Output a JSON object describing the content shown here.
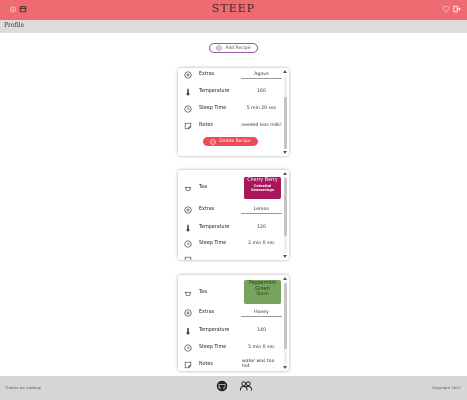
{
  "app": {
    "title": "STEEP",
    "page_title": "Profile"
  },
  "colors": {
    "brand": "#ef6b72",
    "accent": "#9a5aa5",
    "delete": "#ef4a55"
  },
  "header": {
    "left_icons": [
      "tea-cup-icon",
      "tea-tin-icon"
    ],
    "right_icons": [
      "heart-icon",
      "logout-icon"
    ]
  },
  "add_button": {
    "label": "Add Recipe",
    "icon": "plus-circle-icon"
  },
  "labels": {
    "tea": "Tea",
    "extras": "Extras",
    "temperature": "Temperature",
    "steep_time": "Steep Time",
    "notes": "Notes",
    "delete": "Delete Recipe"
  },
  "recipes": [
    {
      "extras": "Agave",
      "temperature": "160",
      "steep_time": "5 min 20 sec",
      "notes": "needed less milk!"
    },
    {
      "tea_name": "Cherry Berry",
      "tea_brand": "Celestial Seasonings",
      "tea_color": "#a8165b",
      "extras": "Lemon",
      "temperature": "120",
      "steep_time": "2 min 0 sec"
    },
    {
      "tea_name": "Peppermint Green",
      "tea_brand": "Stash",
      "tea_color": "#78a35c",
      "extras": "Honey",
      "temperature": "140",
      "steep_time": "5 min 0 sec",
      "notes": "water was too hot"
    }
  ],
  "footer": {
    "left_text": "Thanks for visiting!",
    "right_text": "Copyright 2021",
    "icons": [
      "github-icon",
      "team-icon"
    ]
  }
}
